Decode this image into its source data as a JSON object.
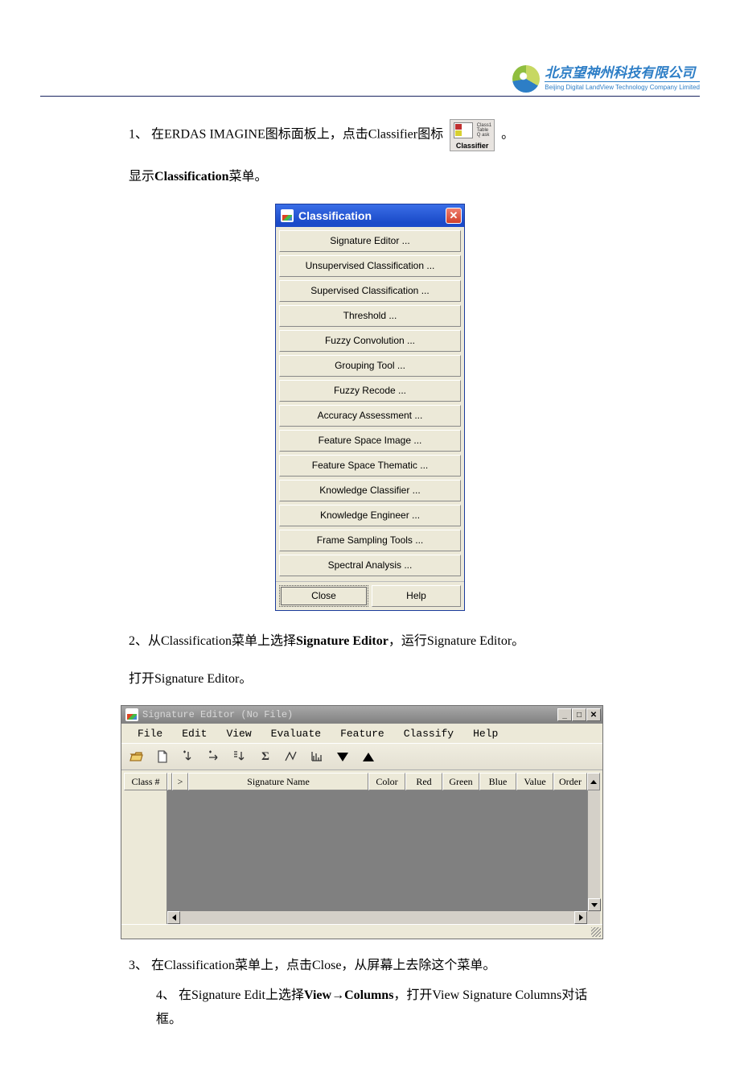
{
  "header": {
    "company_cn": "北京望神州科技有限公司",
    "company_en": "Beijing Digital LandView Technology Company Limited"
  },
  "step1": {
    "prefix": "1、 在ERDAS IMAGINE图标面板上，点击Classifier图标",
    "icon_label": "Classifier",
    "suffix": " 。"
  },
  "line_show": {
    "a": "显示",
    "b": "Classification",
    "c": "菜单。"
  },
  "class_dialog": {
    "title": "Classification",
    "items": [
      "Signature Editor ...",
      "Unsupervised Classification ...",
      "Supervised Classification ...",
      "Threshold ...",
      "Fuzzy Convolution ...",
      "Grouping Tool ...",
      "Fuzzy Recode ...",
      "Accuracy Assessment ...",
      "Feature Space Image ...",
      "Feature Space Thematic ...",
      "Knowledge Classifier ...",
      "Knowledge Engineer ...",
      "Frame Sampling Tools ...",
      "Spectral Analysis ..."
    ],
    "close": "Close",
    "help": "Help"
  },
  "step2": {
    "a": "2、从Classification菜单上选择",
    "b": "Signature Editor",
    "c": "，运行Signature Editor。"
  },
  "line_open": "打开Signature Editor。",
  "sig_editor": {
    "title": "Signature Editor (No File)",
    "menus": [
      "File",
      "Edit",
      "View",
      "Evaluate",
      "Feature",
      "Classify",
      "Help"
    ],
    "columns": [
      "Class #",
      ">",
      "Signature Name",
      "Color",
      "Red",
      "Green",
      "Blue",
      "Value",
      "Order"
    ]
  },
  "step3": "3、 在Classification菜单上，点击Close，从屏幕上去除这个菜单。",
  "step4": {
    "a": "4、 在Signature Edit上选择",
    "b": "View→Columns",
    "c": "，打开View Signature Columns对话框。"
  }
}
